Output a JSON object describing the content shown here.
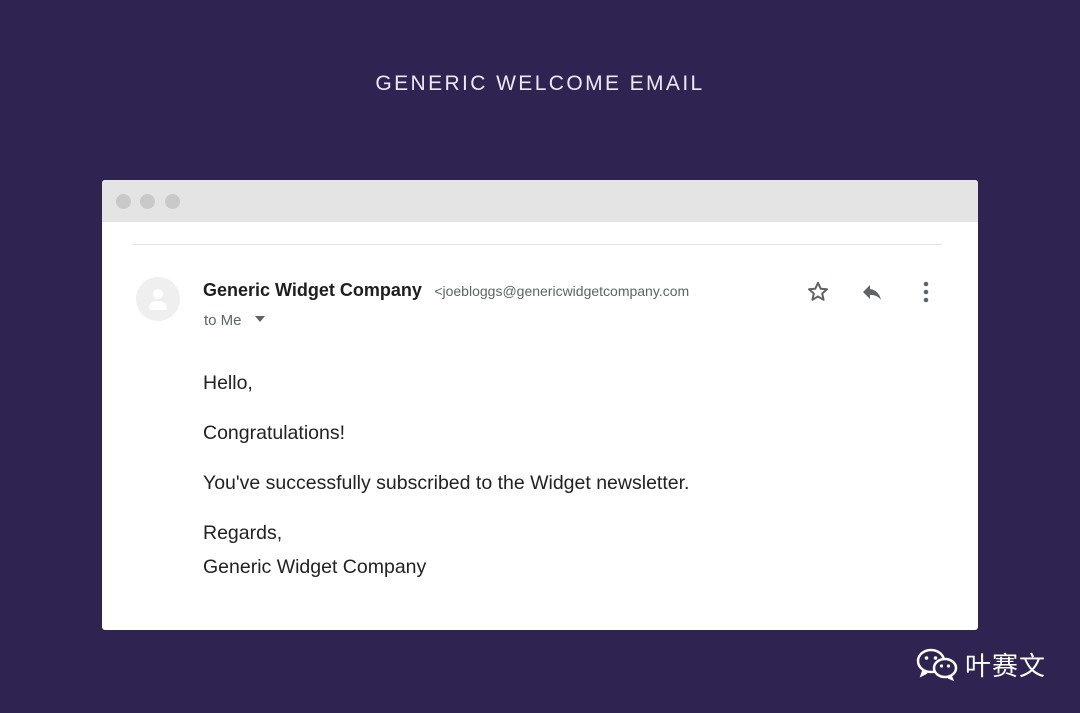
{
  "header": {
    "title": "GENERIC WELCOME EMAIL"
  },
  "email": {
    "sender_name": "Generic Widget Company",
    "sender_email": "<joebloggs@genericwidgetcompany.com",
    "recipient": "to Me",
    "body": {
      "greeting": "Hello,",
      "line1": "Congratulations!",
      "line2": "You've successfully subscribed to the Widget newsletter.",
      "signoff": "Regards,",
      "signature": "Generic Widget Company"
    },
    "actions": [
      "star-icon",
      "reply-icon",
      "more-vert-icon"
    ]
  },
  "window": {
    "controls": [
      "window-dot",
      "window-dot",
      "window-dot"
    ]
  },
  "watermark": {
    "text": "叶赛文",
    "icon": "wechat-icon"
  },
  "colors": {
    "background": "#2f2352",
    "titlebar": "#e4e4e4",
    "card": "#ffffff"
  }
}
